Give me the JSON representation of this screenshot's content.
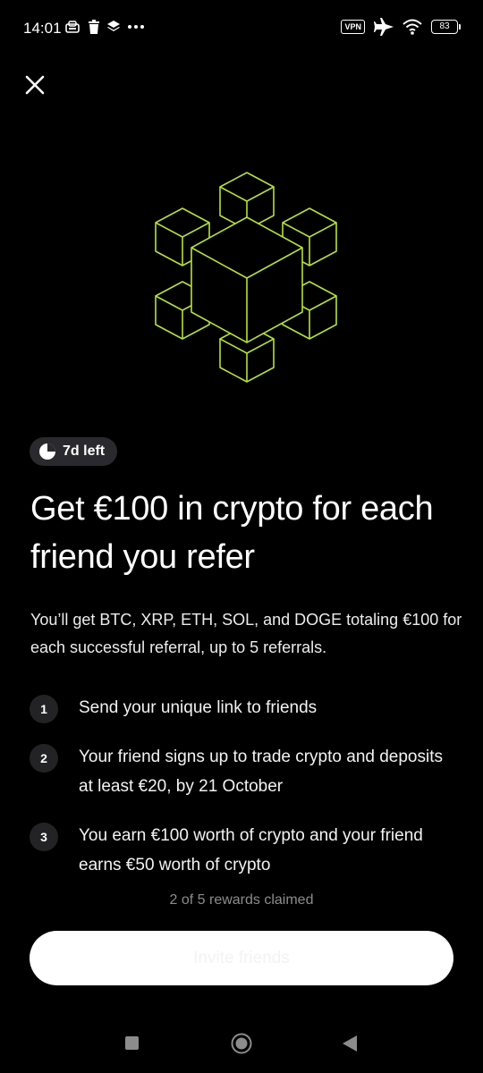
{
  "status_bar": {
    "time": "14:01",
    "left_icons": [
      "notification-app-icon",
      "trash-icon",
      "layers-icon",
      "more-dots-icon"
    ],
    "vpn_label": "VPN",
    "battery_level": "83"
  },
  "header": {
    "close_icon": "close-icon"
  },
  "hero": {
    "icon": "cube-network-icon",
    "stroke_color": "#b6e03a"
  },
  "timer": {
    "label": "7d left",
    "icon": "clock-icon"
  },
  "title": "Get €100 in crypto for each friend you refer",
  "description": "You’ll get BTC, XRP, ETH, SOL, and DOGE totaling €100 for each successful referral, up to 5 referrals.",
  "steps": [
    {
      "number": "1",
      "text": "Send your unique link to friends"
    },
    {
      "number": "2",
      "text": "Your friend signs up to trade crypto and deposits at least €20, by 21 October"
    },
    {
      "number": "3",
      "text": "You earn €100 worth of crypto and your friend earns €50 worth of crypto"
    }
  ],
  "progress": {
    "label": "2 of 5 rewards claimed",
    "claimed": 2,
    "total": 5
  },
  "cta": {
    "label": "Invite friends"
  },
  "navigation": {
    "recents_icon": "square-icon",
    "home_icon": "circle-home-icon",
    "back_icon": "triangle-back-icon"
  },
  "colors": {
    "background": "#000000",
    "accent": "#b6e03a",
    "badge_bg": "#2a2a2e",
    "muted_text": "#8c8c8c",
    "button_bg": "#ffffff"
  }
}
